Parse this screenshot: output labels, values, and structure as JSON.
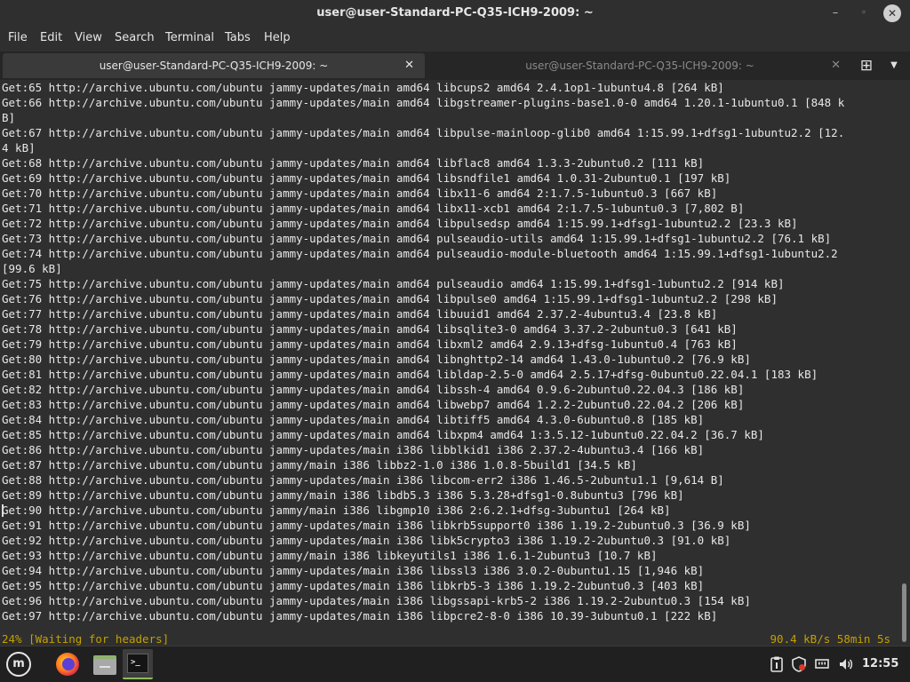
{
  "window": {
    "title": "user@user-Standard-PC-Q35-ICH9-2009: ~"
  },
  "window_controls": {
    "minimize": "–",
    "maximize": "◦",
    "close": "✕"
  },
  "menu": [
    "File",
    "Edit",
    "View",
    "Search",
    "Terminal",
    "Tabs",
    "Help"
  ],
  "tabs": [
    {
      "label": "user@user-Standard-PC-Q35-ICH9-2009: ~",
      "close": "✕",
      "active": true
    },
    {
      "label": "user@user-Standard-PC-Q35-ICH9-2009: ~",
      "close": "✕",
      "active": false
    }
  ],
  "tab_controls": {
    "new_tab": "⊞",
    "tab_menu": "▼"
  },
  "terminal": {
    "lines": [
      "Get:65 http://archive.ubuntu.com/ubuntu jammy-updates/main amd64 libcups2 amd64 2.4.1op1-1ubuntu4.8 [264 kB]",
      "Get:66 http://archive.ubuntu.com/ubuntu jammy-updates/main amd64 libgstreamer-plugins-base1.0-0 amd64 1.20.1-1ubuntu0.1 [848 k",
      "B]",
      "Get:67 http://archive.ubuntu.com/ubuntu jammy-updates/main amd64 libpulse-mainloop-glib0 amd64 1:15.99.1+dfsg1-1ubuntu2.2 [12.",
      "4 kB]",
      "Get:68 http://archive.ubuntu.com/ubuntu jammy-updates/main amd64 libflac8 amd64 1.3.3-2ubuntu0.2 [111 kB]",
      "Get:69 http://archive.ubuntu.com/ubuntu jammy-updates/main amd64 libsndfile1 amd64 1.0.31-2ubuntu0.1 [197 kB]",
      "Get:70 http://archive.ubuntu.com/ubuntu jammy-updates/main amd64 libx11-6 amd64 2:1.7.5-1ubuntu0.3 [667 kB]",
      "Get:71 http://archive.ubuntu.com/ubuntu jammy-updates/main amd64 libx11-xcb1 amd64 2:1.7.5-1ubuntu0.3 [7,802 B]",
      "Get:72 http://archive.ubuntu.com/ubuntu jammy-updates/main amd64 libpulsedsp amd64 1:15.99.1+dfsg1-1ubuntu2.2 [23.3 kB]",
      "Get:73 http://archive.ubuntu.com/ubuntu jammy-updates/main amd64 pulseaudio-utils amd64 1:15.99.1+dfsg1-1ubuntu2.2 [76.1 kB]",
      "Get:74 http://archive.ubuntu.com/ubuntu jammy-updates/main amd64 pulseaudio-module-bluetooth amd64 1:15.99.1+dfsg1-1ubuntu2.2",
      "[99.6 kB]",
      "Get:75 http://archive.ubuntu.com/ubuntu jammy-updates/main amd64 pulseaudio amd64 1:15.99.1+dfsg1-1ubuntu2.2 [914 kB]",
      "Get:76 http://archive.ubuntu.com/ubuntu jammy-updates/main amd64 libpulse0 amd64 1:15.99.1+dfsg1-1ubuntu2.2 [298 kB]",
      "Get:77 http://archive.ubuntu.com/ubuntu jammy-updates/main amd64 libuuid1 amd64 2.37.2-4ubuntu3.4 [23.8 kB]",
      "Get:78 http://archive.ubuntu.com/ubuntu jammy-updates/main amd64 libsqlite3-0 amd64 3.37.2-2ubuntu0.3 [641 kB]",
      "Get:79 http://archive.ubuntu.com/ubuntu jammy-updates/main amd64 libxml2 amd64 2.9.13+dfsg-1ubuntu0.4 [763 kB]",
      "Get:80 http://archive.ubuntu.com/ubuntu jammy-updates/main amd64 libnghttp2-14 amd64 1.43.0-1ubuntu0.2 [76.9 kB]",
      "Get:81 http://archive.ubuntu.com/ubuntu jammy-updates/main amd64 libldap-2.5-0 amd64 2.5.17+dfsg-0ubuntu0.22.04.1 [183 kB]",
      "Get:82 http://archive.ubuntu.com/ubuntu jammy-updates/main amd64 libssh-4 amd64 0.9.6-2ubuntu0.22.04.3 [186 kB]",
      "Get:83 http://archive.ubuntu.com/ubuntu jammy-updates/main amd64 libwebp7 amd64 1.2.2-2ubuntu0.22.04.2 [206 kB]",
      "Get:84 http://archive.ubuntu.com/ubuntu jammy-updates/main amd64 libtiff5 amd64 4.3.0-6ubuntu0.8 [185 kB]",
      "Get:85 http://archive.ubuntu.com/ubuntu jammy-updates/main amd64 libxpm4 amd64 1:3.5.12-1ubuntu0.22.04.2 [36.7 kB]",
      "Get:86 http://archive.ubuntu.com/ubuntu jammy-updates/main i386 libblkid1 i386 2.37.2-4ubuntu3.4 [166 kB]",
      "Get:87 http://archive.ubuntu.com/ubuntu jammy/main i386 libbz2-1.0 i386 1.0.8-5build1 [34.5 kB]",
      "Get:88 http://archive.ubuntu.com/ubuntu jammy-updates/main i386 libcom-err2 i386 1.46.5-2ubuntu1.1 [9,614 B]",
      "Get:89 http://archive.ubuntu.com/ubuntu jammy/main i386 libdb5.3 i386 5.3.28+dfsg1-0.8ubuntu3 [796 kB]",
      "Get:90 http://archive.ubuntu.com/ubuntu jammy/main i386 libgmp10 i386 2:6.2.1+dfsg-3ubuntu1 [264 kB]",
      "Get:91 http://archive.ubuntu.com/ubuntu jammy-updates/main i386 libkrb5support0 i386 1.19.2-2ubuntu0.3 [36.9 kB]",
      "Get:92 http://archive.ubuntu.com/ubuntu jammy-updates/main i386 libk5crypto3 i386 1.19.2-2ubuntu0.3 [91.0 kB]",
      "Get:93 http://archive.ubuntu.com/ubuntu jammy/main i386 libkeyutils1 i386 1.6.1-2ubuntu3 [10.7 kB]",
      "Get:94 http://archive.ubuntu.com/ubuntu jammy-updates/main i386 libssl3 i386 3.0.2-0ubuntu1.15 [1,946 kB]",
      "Get:95 http://archive.ubuntu.com/ubuntu jammy-updates/main i386 libkrb5-3 i386 1.19.2-2ubuntu0.3 [403 kB]",
      "Get:96 http://archive.ubuntu.com/ubuntu jammy-updates/main i386 libgssapi-krb5-2 i386 1.19.2-2ubuntu0.3 [154 kB]",
      "Get:97 http://archive.ubuntu.com/ubuntu jammy-updates/main i386 libpcre2-8-0 i386 10.39-3ubuntu0.1 [222 kB]"
    ],
    "status_left": "24% [Waiting for headers]",
    "status_right": "90.4 kB/s 58min 5s"
  },
  "taskbar": {
    "clock": "12:55",
    "mint_logo_glyph": "m",
    "terminal_glyph": ">_",
    "icons": [
      "linux-mint-menu-icon",
      "firefox-icon",
      "files-icon",
      "terminal-icon",
      "clipboard-icon",
      "shield-icon",
      "network-icon",
      "volume-icon"
    ]
  },
  "colors": {
    "status_text": "#c4a000",
    "terminal_bg": "#2f2f2f",
    "terminal_fg": "#e8e8e8"
  }
}
